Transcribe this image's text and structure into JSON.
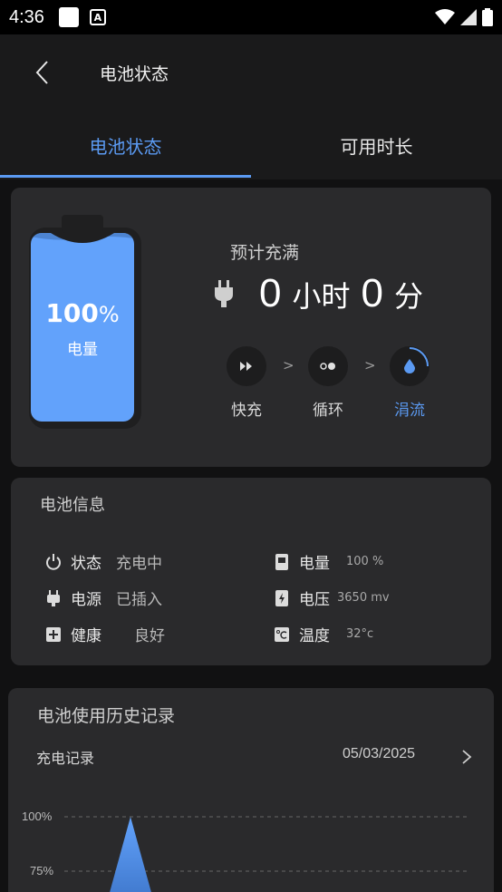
{
  "status_bar": {
    "time": "4:36",
    "notif_icon": "A"
  },
  "header": {
    "title": "电池状态"
  },
  "tabs": [
    {
      "label": "电池状态",
      "active": true
    },
    {
      "label": "可用时长",
      "active": false
    }
  ],
  "battery": {
    "percent": "100",
    "percent_unit": "%",
    "label": "电量",
    "fill_color": "#62a2fb"
  },
  "estimate": {
    "label": "预计充满",
    "hours": "0",
    "hours_unit": "小时",
    "minutes": "0",
    "minutes_unit": "分"
  },
  "modes": [
    {
      "label": "快充",
      "icon": "fast-forward-icon",
      "active": false
    },
    {
      "label": "循环",
      "icon": "cycle-dots-icon",
      "active": false
    },
    {
      "label": "涓流",
      "icon": "droplet-icon",
      "active": true
    }
  ],
  "mode_separator": ">",
  "info": {
    "title": "电池信息",
    "items": [
      {
        "key": "状态",
        "value": "充电中",
        "icon": "power-icon"
      },
      {
        "key": "电源",
        "value": "已插入",
        "icon": "plug-icon"
      },
      {
        "key": "健康",
        "value": "良好",
        "icon": "health-plus-icon"
      },
      {
        "key": "电量",
        "value": "100 %",
        "icon": "battery-level-icon"
      },
      {
        "key": "电压",
        "value": "3650 mv",
        "icon": "voltage-icon"
      },
      {
        "key": "温度",
        "value": "32°c",
        "icon": "temperature-icon"
      }
    ]
  },
  "history": {
    "title": "电池使用历史记录",
    "subtitle": "充电记录",
    "date": "05/03/2025",
    "ticks": [
      "100%",
      "75%"
    ]
  },
  "colors": {
    "accent": "#5b9af2",
    "card": "#2a2a2c",
    "background": "#111112"
  }
}
